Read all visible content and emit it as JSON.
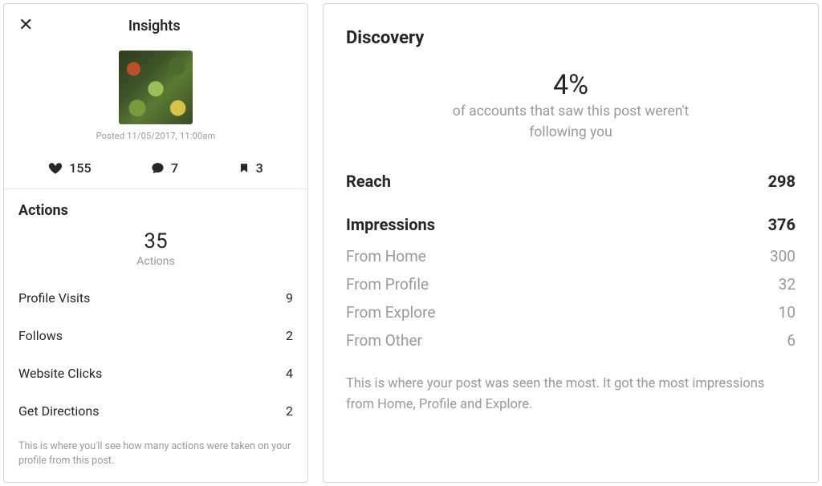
{
  "header": {
    "title": "Insights",
    "close_glyph": "✕"
  },
  "post": {
    "posted_line": "Posted 11/05/2017, 11:00am"
  },
  "engagement": {
    "likes": "155",
    "comments": "7",
    "saves": "3"
  },
  "actions": {
    "title": "Actions",
    "total": "35",
    "total_label": "Actions",
    "rows": [
      {
        "label": "Profile Visits",
        "value": "9"
      },
      {
        "label": "Follows",
        "value": "2"
      },
      {
        "label": "Website Clicks",
        "value": "4"
      },
      {
        "label": "Get Directions",
        "value": "2"
      }
    ],
    "footer": "This is where you'll see how many actions were taken on your profile from this post."
  },
  "discovery": {
    "title": "Discovery",
    "percent": "4%",
    "percent_desc": "of accounts that saw this post weren't following you",
    "reach": {
      "label": "Reach",
      "value": "298"
    },
    "impressions": {
      "label": "Impressions",
      "value": "376",
      "breakdown": [
        {
          "label": "From Home",
          "value": "300"
        },
        {
          "label": "From Profile",
          "value": "32"
        },
        {
          "label": "From Explore",
          "value": "10"
        },
        {
          "label": "From Other",
          "value": "6"
        }
      ]
    },
    "footer": "This is where your post was seen the most. It got the most impressions from Home, Profile and Explore."
  }
}
